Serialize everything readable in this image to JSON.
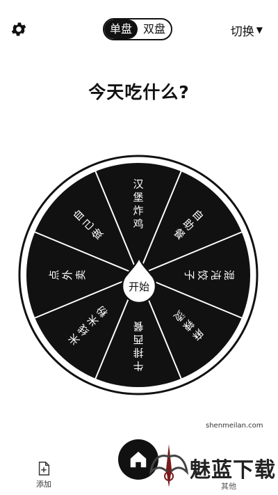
{
  "header": {
    "settings_icon": "gear-icon",
    "mode_tabs": [
      {
        "label": "单盘",
        "active": true
      },
      {
        "label": "双盘",
        "active": false
      }
    ],
    "switch_label": "切换",
    "switch_caret": "▼"
  },
  "question": "今天吃什么?",
  "wheel": {
    "segments": [
      "汉堡炸鸡",
      "自助餐",
      "混沌饺子",
      "麻辣烫",
      "牛排西餐",
      "米线米粉",
      "点外卖",
      "自己做"
    ],
    "start_label": "开始",
    "colors": {
      "segment": "#111111",
      "divider": "#ffffff",
      "text": "#ffffff"
    }
  },
  "bottom_nav": {
    "add_label": "添加",
    "add_icon": "add-file-icon",
    "home_icon": "home-icon",
    "more_label": "其他"
  },
  "watermark": {
    "text": "魅蓝下载",
    "url": "shenmeilan.com"
  }
}
